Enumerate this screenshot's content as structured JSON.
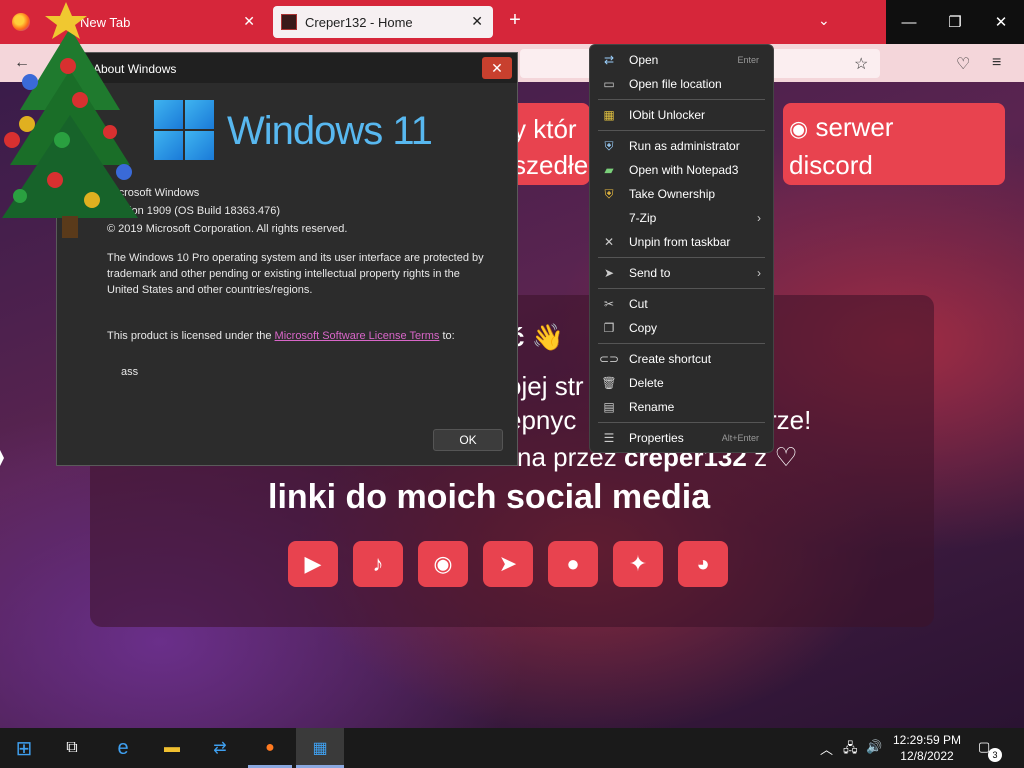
{
  "browser": {
    "tabs": [
      {
        "label": "New Tab",
        "active": false
      },
      {
        "label": "Creper132 - Home",
        "active": true
      }
    ],
    "accent": "#d6263a"
  },
  "page": {
    "pill_left_lines": [
      "y któr",
      "szedłe"
    ],
    "pill_right_lines": [
      "serwer",
      "discord"
    ],
    "card_lines": [
      "ć",
      "ojej str",
      "ępnyc",
      "rze!",
      "na przez",
      "creper132",
      "z"
    ],
    "social_title": "linki do moich social media",
    "social_icons": [
      "youtube-icon",
      "tiktok-icon",
      "discord-icon",
      "telegram-icon",
      "github-icon",
      "twitter-icon",
      "reddit-icon"
    ]
  },
  "about": {
    "title": "About Windows",
    "logo_text": "Windows 11",
    "line1": "Microsoft Windows",
    "line2": "Version 1909 (OS Build 18363.476)",
    "line3": "© 2019 Microsoft Corporation. All rights reserved.",
    "para1": "The Windows 10 Pro operating system and its user interface are protected by trademark and other pending or existing intellectual property rights in the United States and other countries/regions.",
    "license_prefix": "This product is licensed under the",
    "license_link": "Microsoft Software License Terms",
    "license_suffix": "to:",
    "licensee": "ass",
    "ok_label": "OK"
  },
  "context_menu": {
    "items": [
      {
        "label": "Open",
        "shortcut": "Enter",
        "icon": "teamviewer-icon"
      },
      {
        "label": "Open file location",
        "icon": "folder-icon"
      },
      {
        "sep": true
      },
      {
        "label": "IObit Unlocker",
        "icon": "unlocker-icon"
      },
      {
        "sep": true
      },
      {
        "label": "Run as administrator",
        "icon": "shield-icon"
      },
      {
        "label": "Open with Notepad3",
        "icon": "notepad-icon"
      },
      {
        "label": "Take Ownership",
        "icon": "uac-shield-icon"
      },
      {
        "label": "7-Zip",
        "submenu": true
      },
      {
        "label": "Unpin from taskbar",
        "icon": "unpin-icon"
      },
      {
        "sep": true
      },
      {
        "label": "Send to",
        "submenu": true,
        "icon": "send-icon"
      },
      {
        "sep": true
      },
      {
        "label": "Cut",
        "icon": "scissors-icon"
      },
      {
        "label": "Copy",
        "icon": "copy-icon"
      },
      {
        "sep": true
      },
      {
        "label": "Create shortcut",
        "icon": "link-icon"
      },
      {
        "label": "Delete",
        "icon": "trash-icon"
      },
      {
        "label": "Rename",
        "icon": "rename-icon"
      },
      {
        "sep": true
      },
      {
        "label": "Properties",
        "shortcut": "Alt+Enter",
        "icon": "properties-icon"
      }
    ]
  },
  "taskbar": {
    "time": "12:29:59 PM",
    "date": "12/8/2022",
    "notification_count": "3"
  }
}
